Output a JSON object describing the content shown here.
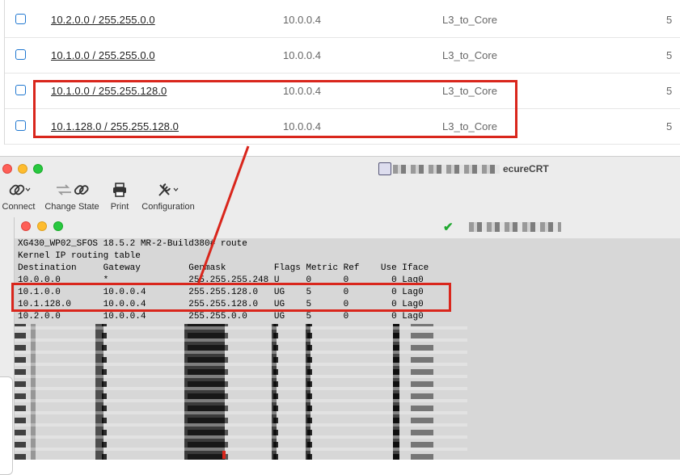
{
  "routes_table": {
    "rows": [
      {
        "network": "10.2.0.0 / 255.255.0.0",
        "gateway": "10.0.0.4",
        "zone": "L3_to_Core",
        "metric": "5"
      },
      {
        "network": "10.1.0.0 / 255.255.0.0",
        "gateway": "10.0.0.4",
        "zone": "L3_to_Core",
        "metric": "5"
      },
      {
        "network": "10.1.0.0 / 255.255.128.0",
        "gateway": "10.0.0.4",
        "zone": "L3_to_Core",
        "metric": "5"
      },
      {
        "network": "10.1.128.0 / 255.255.128.0",
        "gateway": "10.0.0.4",
        "zone": "L3_to_Core",
        "metric": "5"
      }
    ]
  },
  "securecrt": {
    "title": "ecureCRT",
    "toolbar": {
      "connect": "Connect",
      "change_state": "Change State",
      "print": "Print",
      "configuration": "Configuration"
    },
    "terminal_lines": [
      "XG430_WP02_SFOS 18.5.2 MR-2-Build380# route",
      "Kernel IP routing table",
      "Destination     Gateway         Genmask         Flags Metric Ref    Use Iface",
      "10.0.0.0        *               255.255.255.248 U     0      0        0 Lag0",
      "10.1.0.0        10.0.0.4        255.255.128.0   UG    5      0        0 Lag0",
      "10.1.128.0      10.0.0.4        255.255.128.0   UG    5      0        0 Lag0",
      "10.2.0.0        10.0.0.4        255.255.0.0     UG    5      0        0 Lag0"
    ]
  },
  "colors": {
    "highlight": "#d9261c",
    "checkbox": "#1f77d0",
    "connected": "#1fa82f"
  }
}
